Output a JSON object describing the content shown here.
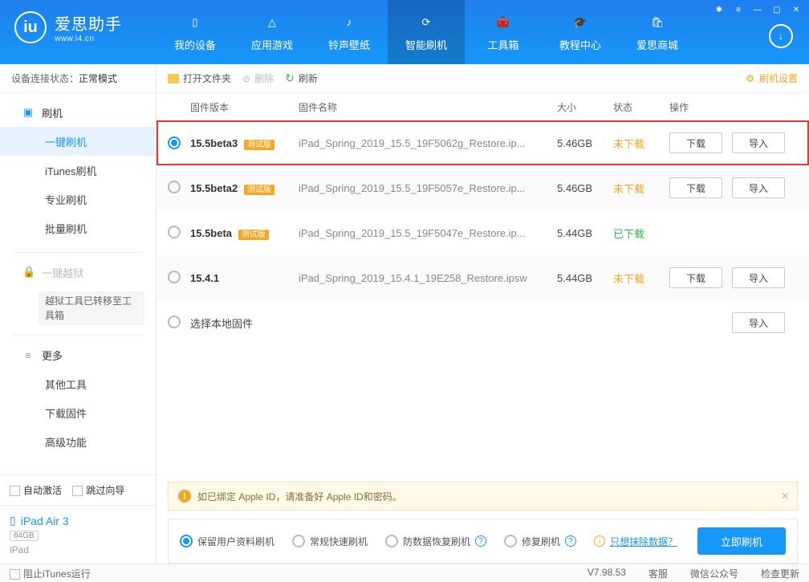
{
  "app": {
    "name": "爱思助手",
    "url": "www.i4.cn",
    "version": "V7.98.53"
  },
  "titlebar": {
    "tip": "✱",
    "menu": "≡",
    "min": "—",
    "max": "▢",
    "close": "✕"
  },
  "topnav": [
    {
      "label": "我的设备",
      "icon": "device"
    },
    {
      "label": "应用游戏",
      "icon": "apps"
    },
    {
      "label": "铃声壁纸",
      "icon": "media"
    },
    {
      "label": "智能刷机",
      "icon": "flash",
      "active": true
    },
    {
      "label": "工具箱",
      "icon": "toolbox"
    },
    {
      "label": "教程中心",
      "icon": "tutorial"
    },
    {
      "label": "爱思商城",
      "icon": "shop"
    }
  ],
  "sidebar": {
    "status_label": "设备连接状态：",
    "status_value": "正常模式",
    "sections": {
      "flash": {
        "label": "刷机",
        "items": [
          "一键刷机",
          "iTunes刷机",
          "专业刷机",
          "批量刷机"
        ],
        "active": 0
      },
      "jailbreak": {
        "label": "一键越狱",
        "note": "越狱工具已转移至工具箱"
      },
      "more": {
        "label": "更多",
        "items": [
          "其他工具",
          "下载固件",
          "高级功能"
        ]
      }
    },
    "auto_activate": "自动激活",
    "skip_guide": "跳过向导",
    "device": {
      "name": "iPad Air 3",
      "capacity": "64GB",
      "type": "iPad"
    }
  },
  "toolbar": {
    "open": "打开文件夹",
    "delete": "删除",
    "refresh": "刷新",
    "settings": "刷机设置"
  },
  "table": {
    "head": {
      "ver": "固件版本",
      "name": "固件名称",
      "size": "大小",
      "status": "状态",
      "ops": "操作"
    },
    "btn_download": "下载",
    "btn_import": "导入",
    "beta_tag": "测试版",
    "rows": [
      {
        "ver": "15.5beta3",
        "beta": true,
        "name": "iPad_Spring_2019_15.5_19F5062g_Restore.ip...",
        "size": "5.46GB",
        "status": "未下载",
        "st": "und",
        "sel": true,
        "dl": true,
        "imp": true,
        "hl": true
      },
      {
        "ver": "15.5beta2",
        "beta": true,
        "name": "iPad_Spring_2019_15.5_19F5057e_Restore.ip...",
        "size": "5.46GB",
        "status": "未下载",
        "st": "und",
        "dl": true,
        "imp": true
      },
      {
        "ver": "15.5beta",
        "beta": true,
        "name": "iPad_Spring_2019_15.5_19F5047e_Restore.ip...",
        "size": "5.44GB",
        "status": "已下载",
        "st": "done"
      },
      {
        "ver": "15.4.1",
        "beta": false,
        "name": "iPad_Spring_2019_15.4.1_19E258_Restore.ipsw",
        "size": "5.44GB",
        "status": "未下载",
        "st": "und",
        "dl": true,
        "imp": true
      },
      {
        "ver": "",
        "custom": "选择本地固件",
        "imp": true
      }
    ]
  },
  "notice": "如已绑定 Apple ID，请准备好 Apple ID和密码。",
  "options": {
    "keep": "保留用户资料刷机",
    "normal": "常规快速刷机",
    "anti": "防数据恢复刷机",
    "repair": "修复刷机",
    "erase": "只想抹除数据？",
    "flash": "立即刷机"
  },
  "statusbar": {
    "block": "阻止iTunes运行",
    "kefu": "客服",
    "wechat": "微信公众号",
    "update": "检查更新"
  }
}
